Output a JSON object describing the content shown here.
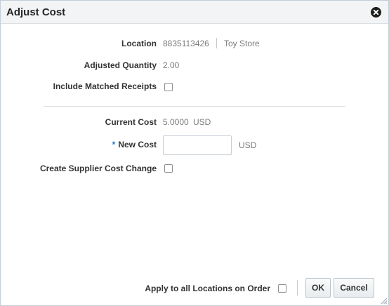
{
  "dialog": {
    "title": "Adjust Cost",
    "close_icon": "close-icon"
  },
  "fields": {
    "location": {
      "label": "Location",
      "id": "8835113426",
      "name": "Toy Store"
    },
    "adjusted_quantity": {
      "label": "Adjusted Quantity",
      "value": "2.00"
    },
    "include_matched_receipts": {
      "label": "Include Matched Receipts",
      "checked": false
    },
    "current_cost": {
      "label": "Current Cost",
      "value": "5.0000",
      "currency": "USD"
    },
    "new_cost": {
      "required_mark": "*",
      "label": "New Cost",
      "value": "",
      "currency": "USD"
    },
    "create_supplier_cost_change": {
      "label": "Create Supplier Cost Change",
      "checked": false
    }
  },
  "footer": {
    "apply_all_label": "Apply to all Locations on Order",
    "apply_all_checked": false,
    "ok_label": "OK",
    "cancel_label": "Cancel"
  }
}
